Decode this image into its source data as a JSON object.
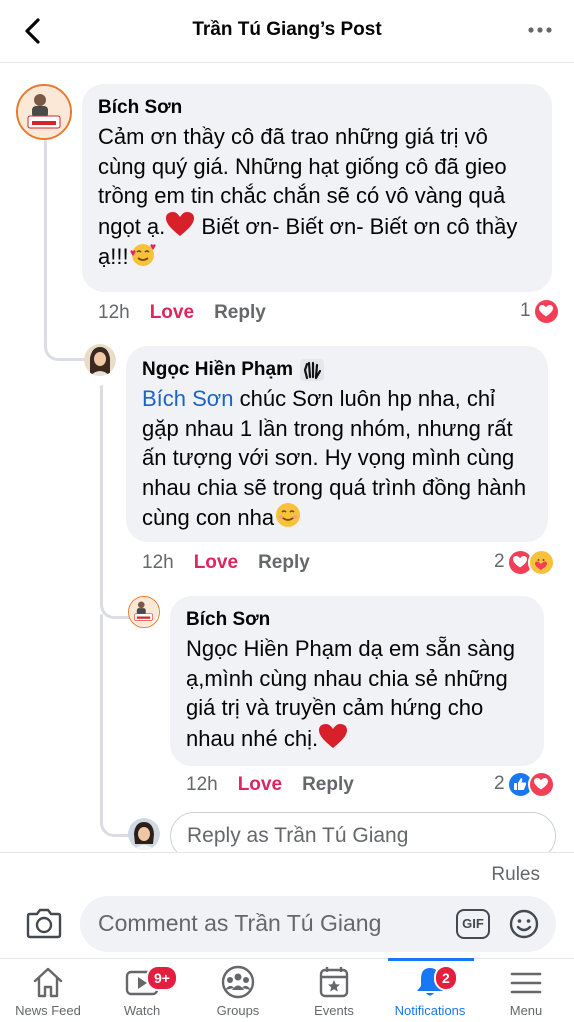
{
  "header": {
    "title": "Trần Tú Giang’s Post"
  },
  "comments": [
    {
      "author": "Bích Sơn",
      "text": "Cảm ơn thầy cô đã trao những giá trị vô cùng quý giá. Những hạt giống cô đã gieo trồng em tin chắc chắn sẽ có vô vàng quả ngọt ạ.",
      "text_tail": " Biết ơn- Biết ơn- Biết ơn cô thầy ạ!!!",
      "avatar_text": "Giải Phóng TRẺ EM",
      "time": "12h",
      "love_label": "Love",
      "reply_label": "Reply",
      "reaction_count": "1"
    },
    {
      "author": "Ngọc Hiền Phạm",
      "mention": "Bích Sơn",
      "text": " chúc Sơn luôn hp nha, chỉ gặp nhau 1 lần trong nhóm, nhưng rất ấn tượng với sơn. Hy vọng mình cùng nhau chia sẽ trong quá trình đồng hành cùng con nha",
      "time": "12h",
      "love_label": "Love",
      "reply_label": "Reply",
      "reaction_count": "2"
    },
    {
      "author": "Bích Sơn",
      "text": "Ngọc Hiền Phạm dạ em sẵn sàng ạ,mình cùng nhau chia sẻ những giá trị và truyền cảm hứng cho nhau nhé chị.",
      "time": "12h",
      "love_label": "Love",
      "reply_label": "Reply",
      "reaction_count": "2"
    }
  ],
  "reply_input": {
    "placeholder": "Reply as Trần Tú Giang"
  },
  "composer": {
    "rules_label": "Rules",
    "placeholder": "Comment as Trần Tú Giang",
    "gif_label": "GIF"
  },
  "tabs": [
    {
      "label": "News Feed",
      "icon": "home-icon"
    },
    {
      "label": "Watch",
      "icon": "video-icon",
      "badge": "9+"
    },
    {
      "label": "Groups",
      "icon": "groups-icon"
    },
    {
      "label": "Events",
      "icon": "calendar-star-icon"
    },
    {
      "label": "Notifications",
      "icon": "bell-icon",
      "badge": "2",
      "active": true
    },
    {
      "label": "Menu",
      "icon": "hamburger-icon"
    }
  ],
  "colors": {
    "love": "#e0245e",
    "mention": "#1b63c7",
    "active": "#1877f2",
    "badge": "#e41e3f",
    "bubble": "#f0f2f5"
  }
}
